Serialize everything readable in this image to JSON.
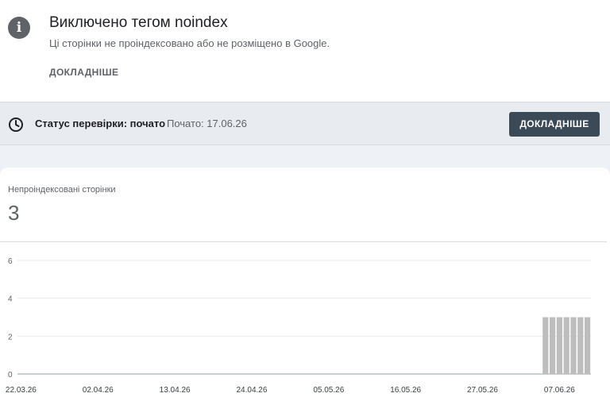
{
  "issue": {
    "icon": "info-icon",
    "title": "Виключено тегом noindex",
    "subtitle": "Ці сторінки не проіндексовано або не розміщено в Google.",
    "more_label": "ДОКЛАДНІШЕ"
  },
  "validation": {
    "icon": "clock-icon",
    "status_label": "Статус перевірки: почато",
    "started_text": "Почато: 17.06.26",
    "button_label": "ДОКЛАДНІШЕ"
  },
  "metric": {
    "label": "Непроіндексовані сторінки",
    "value": "3"
  },
  "colors": {
    "bar": "#bdbdbd",
    "button": "#3c4a57"
  },
  "chart_data": {
    "type": "bar",
    "ylim": [
      0,
      6
    ],
    "yticks": [
      "0",
      "2",
      "4",
      "6"
    ],
    "date_start": "22.03.26",
    "date_end": "11.06.26",
    "xtick_labels": [
      "22.03.26",
      "02.04.26",
      "13.04.26",
      "24.04.26",
      "05.05.26",
      "16.05.26",
      "27.05.26",
      "07.06.26"
    ],
    "bars": [
      {
        "date": "05.06.26",
        "value": 3
      },
      {
        "date": "06.06.26",
        "value": 3
      },
      {
        "date": "07.06.26",
        "value": 3
      },
      {
        "date": "08.06.26",
        "value": 3
      },
      {
        "date": "09.06.26",
        "value": 3
      },
      {
        "date": "10.06.26",
        "value": 3
      },
      {
        "date": "11.06.26",
        "value": 3
      }
    ]
  }
}
